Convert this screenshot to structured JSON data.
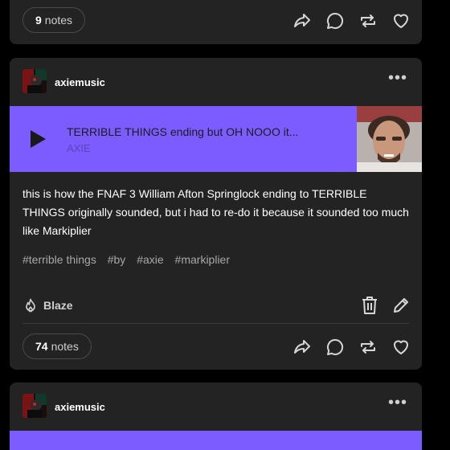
{
  "top_post": {
    "notes_count": "9",
    "notes_label": "notes"
  },
  "main_post": {
    "blog_name": "axiemusic",
    "more_label": "•••",
    "audio": {
      "title": "TERRIBLE THINGS ending but OH NOOO it...",
      "artist": "AXIE"
    },
    "body": "this is how the FNAF 3 William Afton Springlock ending to TERRIBLE THINGS originally sounded, but i had to re-do it because it sounded too much like Markiplier",
    "tags": [
      "#terrible things",
      "#by",
      "#axie",
      "#markiplier"
    ],
    "blaze_label": "Blaze",
    "notes_count": "74",
    "notes_label": "notes"
  },
  "bottom_post": {
    "blog_name": "axiemusic",
    "more_label": "•••"
  },
  "colors": {
    "card_bg": "#232323",
    "audio_bg": "#7c5cff",
    "tag_color": "#a8a8a8"
  },
  "icons": [
    "share-icon",
    "reply-icon",
    "reblog-icon",
    "like-icon",
    "blaze-icon",
    "delete-icon",
    "edit-icon",
    "play-icon",
    "more-icon"
  ]
}
